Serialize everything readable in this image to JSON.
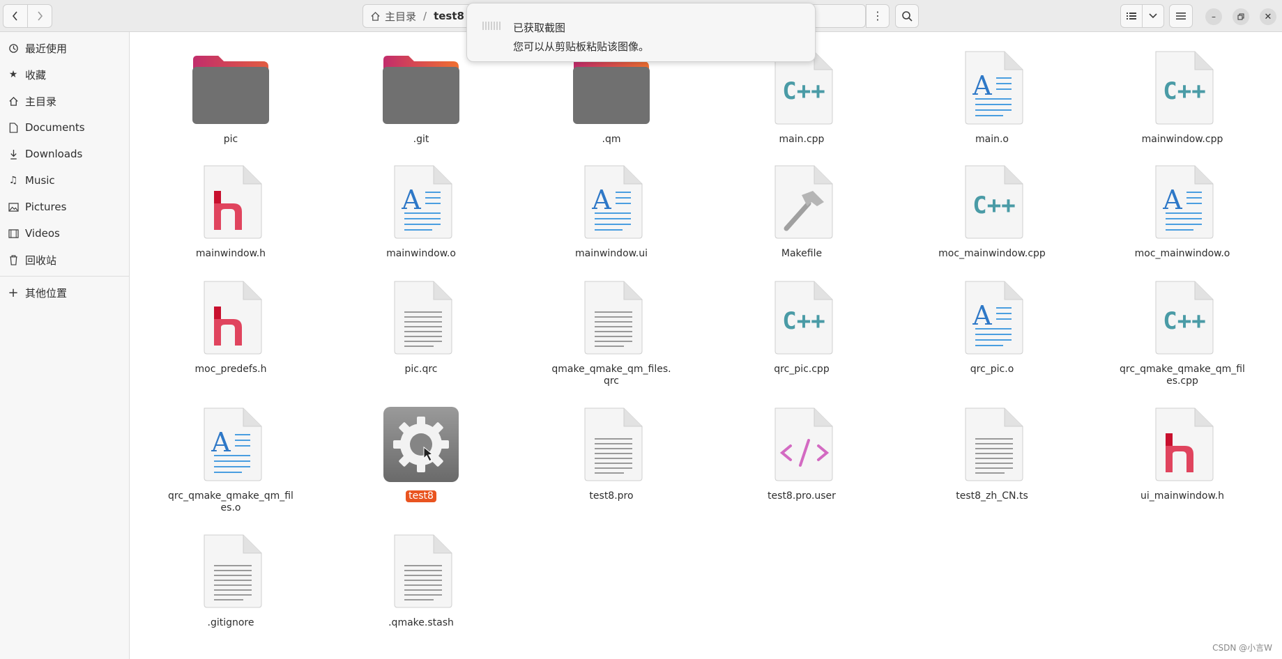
{
  "header": {
    "path_home": "主目录",
    "path_separator": "/",
    "path_current": "test8"
  },
  "sidebar": {
    "items": [
      {
        "label": "最近使用",
        "icon": "clock-icon"
      },
      {
        "label": "收藏",
        "icon": "star-icon"
      },
      {
        "label": "主目录",
        "icon": "home-icon"
      },
      {
        "label": "Documents",
        "icon": "document-icon"
      },
      {
        "label": "Downloads",
        "icon": "download-icon"
      },
      {
        "label": "Music",
        "icon": "music-icon"
      },
      {
        "label": "Pictures",
        "icon": "picture-icon"
      },
      {
        "label": "Videos",
        "icon": "video-icon"
      },
      {
        "label": "回收站",
        "icon": "trash-icon"
      }
    ],
    "other_locations": "其他位置"
  },
  "toast": {
    "title": "已获取截图",
    "body": "您可以从剪贴板粘贴该图像。"
  },
  "files": [
    {
      "name": "pic",
      "type": "folder"
    },
    {
      "name": ".git",
      "type": "folder"
    },
    {
      "name": ".qm",
      "type": "folder"
    },
    {
      "name": "main.cpp",
      "type": "cpp"
    },
    {
      "name": "main.o",
      "type": "object"
    },
    {
      "name": "mainwindow.cpp",
      "type": "cpp"
    },
    {
      "name": "mainwindow.h",
      "type": "header"
    },
    {
      "name": "mainwindow.o",
      "type": "object"
    },
    {
      "name": "mainwindow.ui",
      "type": "object"
    },
    {
      "name": "Makefile",
      "type": "makefile"
    },
    {
      "name": "moc_mainwindow.cpp",
      "type": "cpp"
    },
    {
      "name": "moc_mainwindow.o",
      "type": "object"
    },
    {
      "name": "moc_predefs.h",
      "type": "header"
    },
    {
      "name": "pic.qrc",
      "type": "text"
    },
    {
      "name": "qmake_qmake_qm_files.qrc",
      "type": "text"
    },
    {
      "name": "qrc_pic.cpp",
      "type": "cpp"
    },
    {
      "name": "qrc_pic.o",
      "type": "object"
    },
    {
      "name": "qrc_qmake_qmake_qm_files.cpp",
      "type": "cpp"
    },
    {
      "name": "qrc_qmake_qmake_qm_files.o",
      "type": "object"
    },
    {
      "name": "test8",
      "type": "executable",
      "selected": true
    },
    {
      "name": "test8.pro",
      "type": "text"
    },
    {
      "name": "test8.pro.user",
      "type": "xml"
    },
    {
      "name": "test8_zh_CN.ts",
      "type": "text"
    },
    {
      "name": "ui_mainwindow.h",
      "type": "header"
    },
    {
      "name": ".gitignore",
      "type": "text"
    },
    {
      "name": ".qmake.stash",
      "type": "text"
    }
  ],
  "watermark": "CSDN @小言W",
  "colors": {
    "selection": "#e95420",
    "cpp": "#4a9ba6",
    "header_h": "#e0445e",
    "object_a": "#2e78c7",
    "xml": "#d36ac2",
    "folder": "#6e6e6e"
  }
}
